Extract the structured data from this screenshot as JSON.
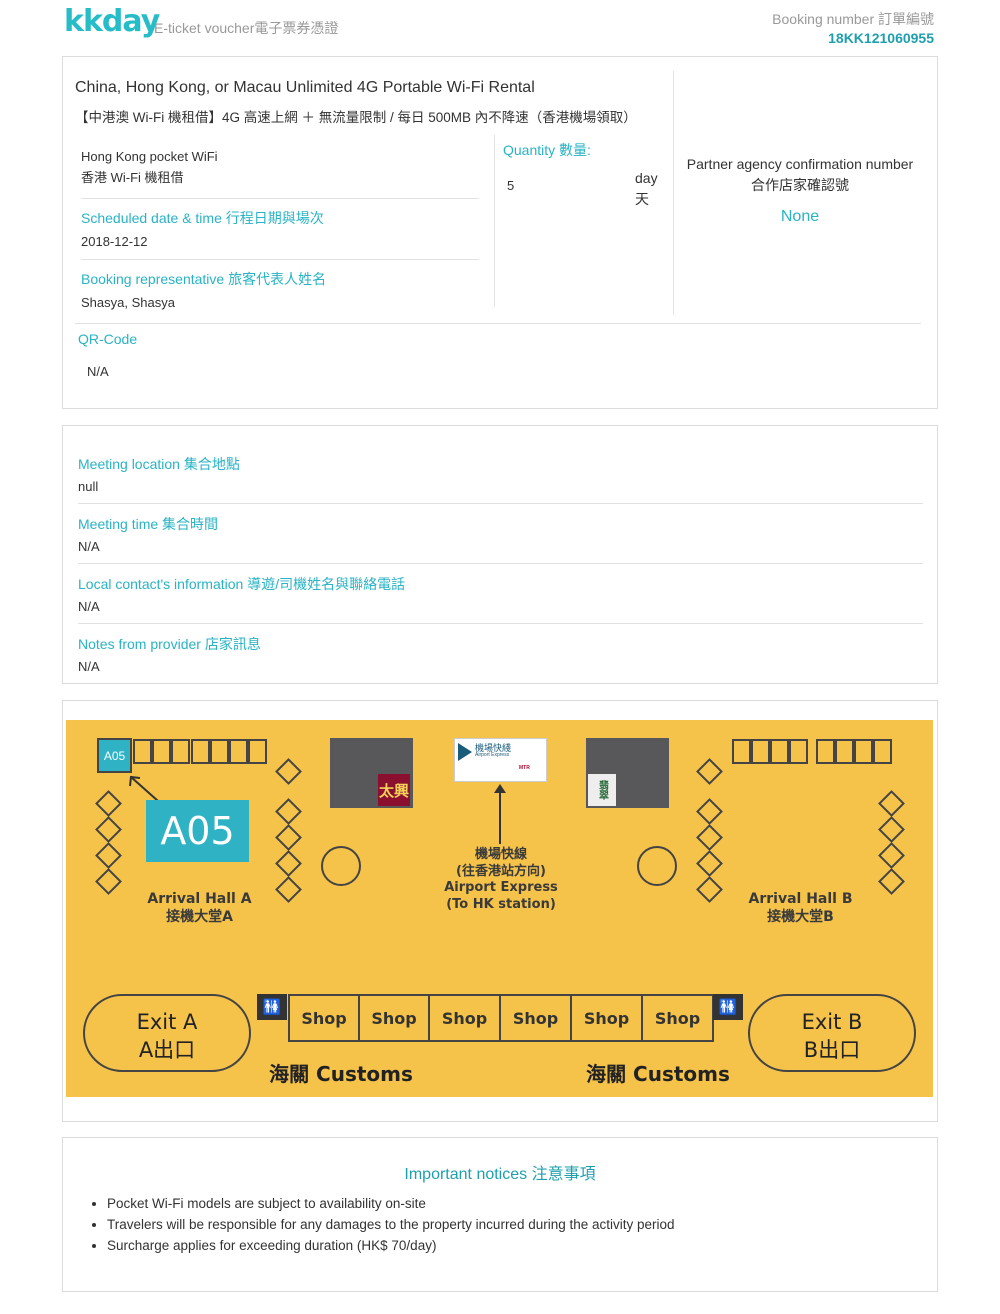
{
  "header": {
    "logo": "kkday",
    "doc_type": "E-ticket voucher電子票券憑證",
    "booking_label": "Booking number 訂單編號",
    "booking_number": "18KK121060955"
  },
  "product": {
    "title": "China, Hong Kong, or Macau Unlimited 4G Portable Wi-Fi Rental",
    "subtitle": "【中港澳 Wi-Fi 機租借】4G 高速上網 ＋ 無流量限制 / 每日 500MB 內不降速（香港機場領取）",
    "package_en": "Hong Kong pocket WiFi",
    "package_zh": "香港 Wi-Fi 機租借",
    "scheduled_label": "Scheduled date & time 行程日期與場次",
    "scheduled_value": "2018-12-12",
    "rep_label": "Booking representative 旅客代表人姓名",
    "rep_value": "Shasya, Shasya",
    "qty_label": "Quantity 數量:",
    "qty_value": "5",
    "qty_unit_en": "day",
    "qty_unit_zh": "天",
    "partner_label_en": "Partner agency confirmation number",
    "partner_label_zh": "合作店家確認號",
    "partner_value": "None",
    "qr_label": "QR-Code",
    "qr_value": "N/A"
  },
  "meeting": {
    "items": [
      {
        "label": "Meeting location 集合地點",
        "value": "null"
      },
      {
        "label": "Meeting time 集合時間",
        "value": "N/A"
      },
      {
        "label": "Local contact's information 導遊/司機姓名與聯絡電話",
        "value": "N/A"
      },
      {
        "label": "Notes from provider 店家訊息",
        "value": "N/A"
      }
    ]
  },
  "map": {
    "counter_small": "A05",
    "counter_big": "A05",
    "arrival_a_en": "Arrival Hall A",
    "arrival_a_zh": "接機大堂A",
    "arrival_b_en": "Arrival Hall B",
    "arrival_b_zh": "接機大堂B",
    "airport_express_zh1": "機場快線",
    "airport_express_zh2": "(往香港站方向)",
    "airport_express_en1": "Airport Express",
    "airport_express_en2": "(To HK station)",
    "exit_a_en": "Exit A",
    "exit_a_zh": "A出口",
    "exit_b_en": "Exit B",
    "exit_b_zh": "B出口",
    "customs_left": "海關 Customs",
    "customs_right": "海關 Customs",
    "shops": [
      "Shop",
      "Shop",
      "Shop",
      "Shop",
      "Shop",
      "Shop"
    ],
    "store_left_sign": "太興",
    "store_right_sign": "翡翠",
    "ae_sign_zh": "機場快綫",
    "ae_sign_en": "Airport Express",
    "ae_sign_mtr": "MTR",
    "wc_symbol": "🚻",
    "colors": {
      "floor": "#f5c24a",
      "counter": "#2fb3c4"
    }
  },
  "notices": {
    "title": "Important notices 注意事項",
    "items": [
      "Pocket Wi-Fi models are subject to availability on-site",
      "Travelers will be responsible for any damages to the property incurred during the activity period",
      "Surcharge applies for exceeding duration (HK$ 70/day)"
    ]
  }
}
